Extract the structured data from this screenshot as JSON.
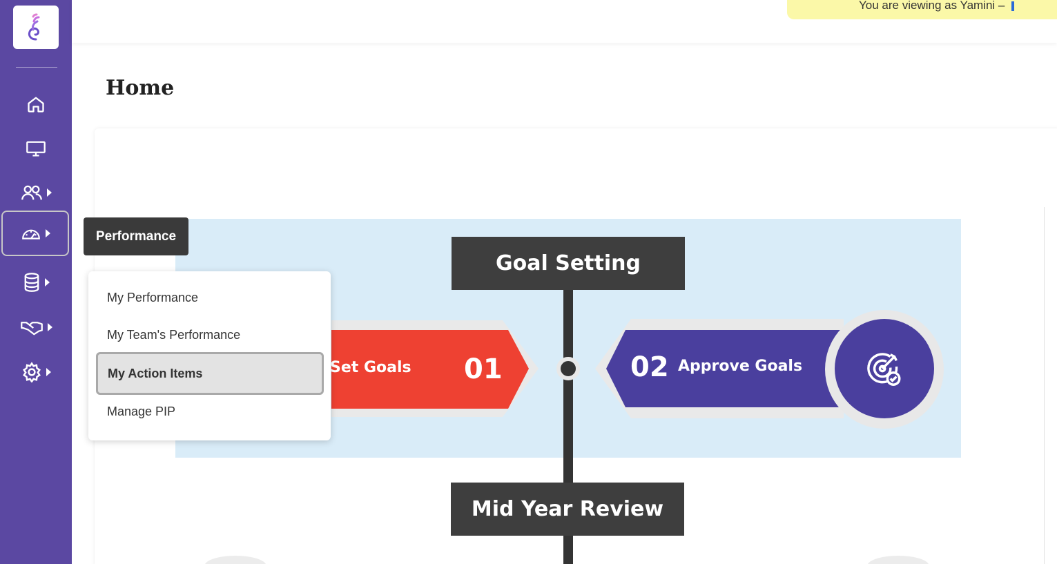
{
  "app": {
    "logo": "spiral-logo-icon",
    "accent": "#5b48a2"
  },
  "banner": {
    "text": "You are viewing as Yamini –"
  },
  "page": {
    "title": "Home"
  },
  "sidebar": {
    "items": [
      {
        "name": "home",
        "icon": "home-icon"
      },
      {
        "name": "desktop",
        "icon": "monitor-icon"
      },
      {
        "name": "people",
        "icon": "users-icon"
      },
      {
        "name": "performance",
        "icon": "gauge-icon",
        "active": true
      },
      {
        "name": "documents",
        "icon": "database-icon"
      },
      {
        "name": "engagement",
        "icon": "handshake-icon"
      },
      {
        "name": "settings",
        "icon": "gear-icon"
      }
    ]
  },
  "tooltip": {
    "label": "Performance"
  },
  "flyout": {
    "items": [
      {
        "label": "My Performance"
      },
      {
        "label": "My Team's Performance"
      },
      {
        "label": "My Action Items",
        "hovered": true
      },
      {
        "label": "Manage PIP"
      }
    ]
  },
  "roadmap": {
    "stage1": {
      "title": "Goal Setting"
    },
    "stage2": {
      "title": "Mid Year Review"
    },
    "step1": {
      "label": "Set Goals",
      "num": "01",
      "color": "#ee4132"
    },
    "step2": {
      "label": "Approve Goals",
      "num": "02",
      "color": "#4a3f9e",
      "icon": "target-check-icon"
    }
  }
}
